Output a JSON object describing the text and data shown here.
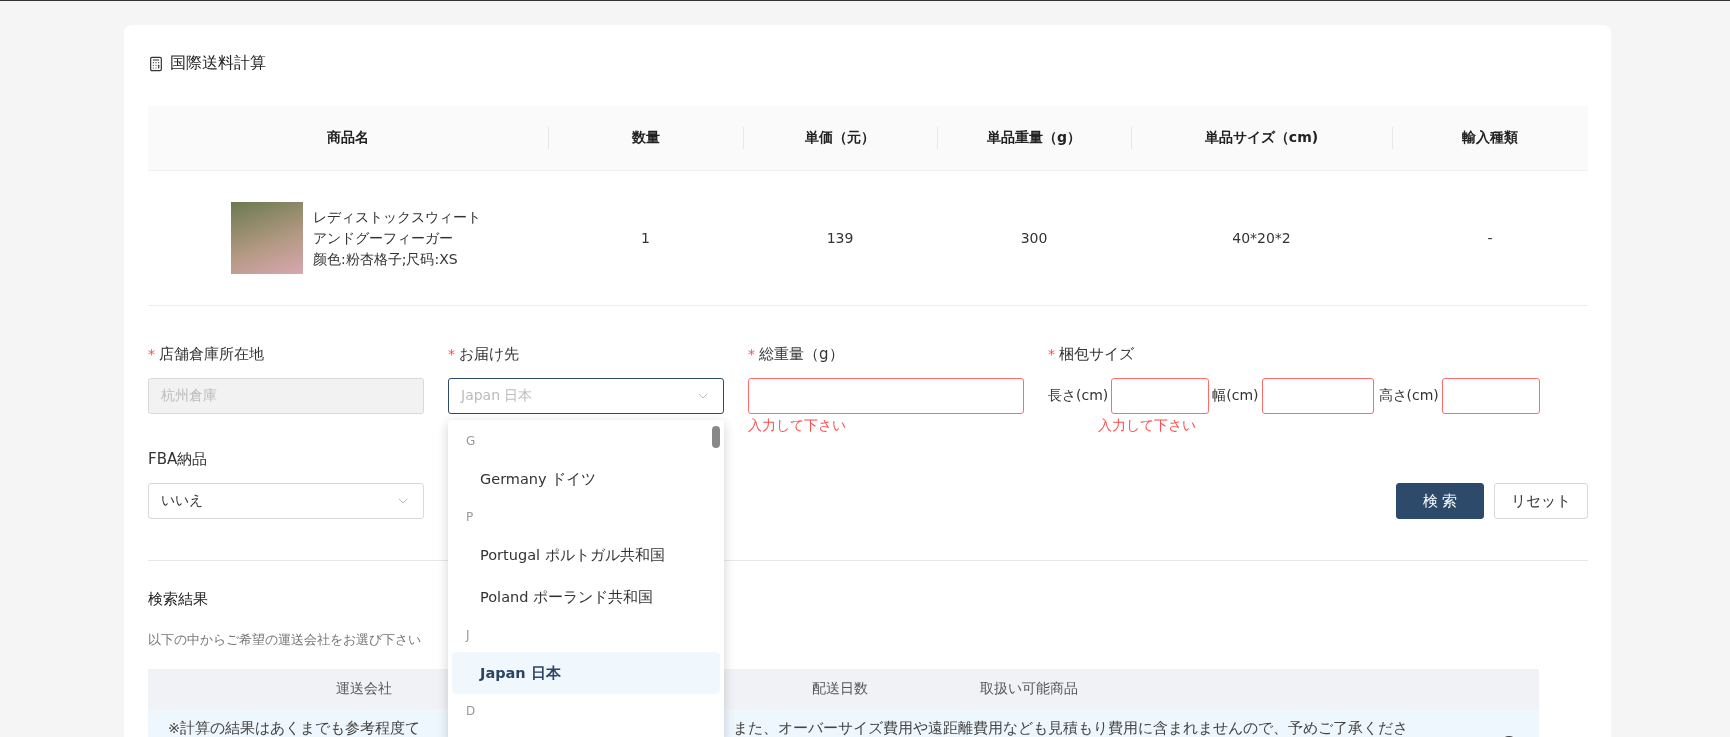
{
  "title": "国際送料計算",
  "product_table": {
    "columns": [
      "商品名",
      "数量",
      "単価（元）",
      "単品重量（g）",
      "単品サイズ（cm)",
      "輸入種類"
    ],
    "rows": [
      {
        "name": "レディストックスウィートアンドグーフィーガー",
        "variant": "颜色:粉杏格子;尺码:XS",
        "quantity": "1",
        "price": "139",
        "weight": "300",
        "size": "40*20*2",
        "import_type": "-"
      }
    ]
  },
  "form": {
    "warehouse": {
      "label": "店舗倉庫所在地",
      "required_mark": "*",
      "disabled": true,
      "value": "杭州倉庫"
    },
    "destination": {
      "label": "お届け先",
      "required_mark": "*",
      "open": true,
      "placeholder": "Japan 日本",
      "groups": [
        {
          "letter": "G",
          "options": [
            {
              "label": "Germany ドイツ",
              "selected": false
            }
          ]
        },
        {
          "letter": "P",
          "options": [
            {
              "label": "Portugal ポルトガル共和国",
              "selected": false
            },
            {
              "label": "Poland ポーランド共和国",
              "selected": false
            }
          ]
        },
        {
          "letter": "J",
          "options": [
            {
              "label": "Japan 日本",
              "selected": true
            }
          ]
        },
        {
          "letter": "D"
        }
      ]
    },
    "total_weight": {
      "label": "総重量（g）",
      "required_mark": "*",
      "error": "入力して下さい"
    },
    "package_size": {
      "label": "梱包サイズ",
      "required_mark": "*",
      "dims": [
        {
          "label": "長さ(cm)"
        },
        {
          "label": "幅(cm)"
        },
        {
          "label": "高さ(cm)"
        }
      ],
      "error": "入力して下さい"
    },
    "fba": {
      "label": "FBA納品",
      "value": "いいえ"
    }
  },
  "buttons": [
    {
      "label": "検 索",
      "kind": "primary"
    },
    {
      "label": "リセット",
      "kind": "default"
    }
  ],
  "results": {
    "title": "検索結果",
    "hint": "以下の中からご希望の運送会社をお選び下さい",
    "columns": [
      "運送会社",
      "配送日数",
      "取扱い可能商品"
    ],
    "notice_parts": [
      "※計算の結果はあくまでも参考程度て",
      "また、オーバーサイズ費用や遠距離費用なども見積もり費用に含まれませんので、予めご了承くださ"
    ]
  }
}
